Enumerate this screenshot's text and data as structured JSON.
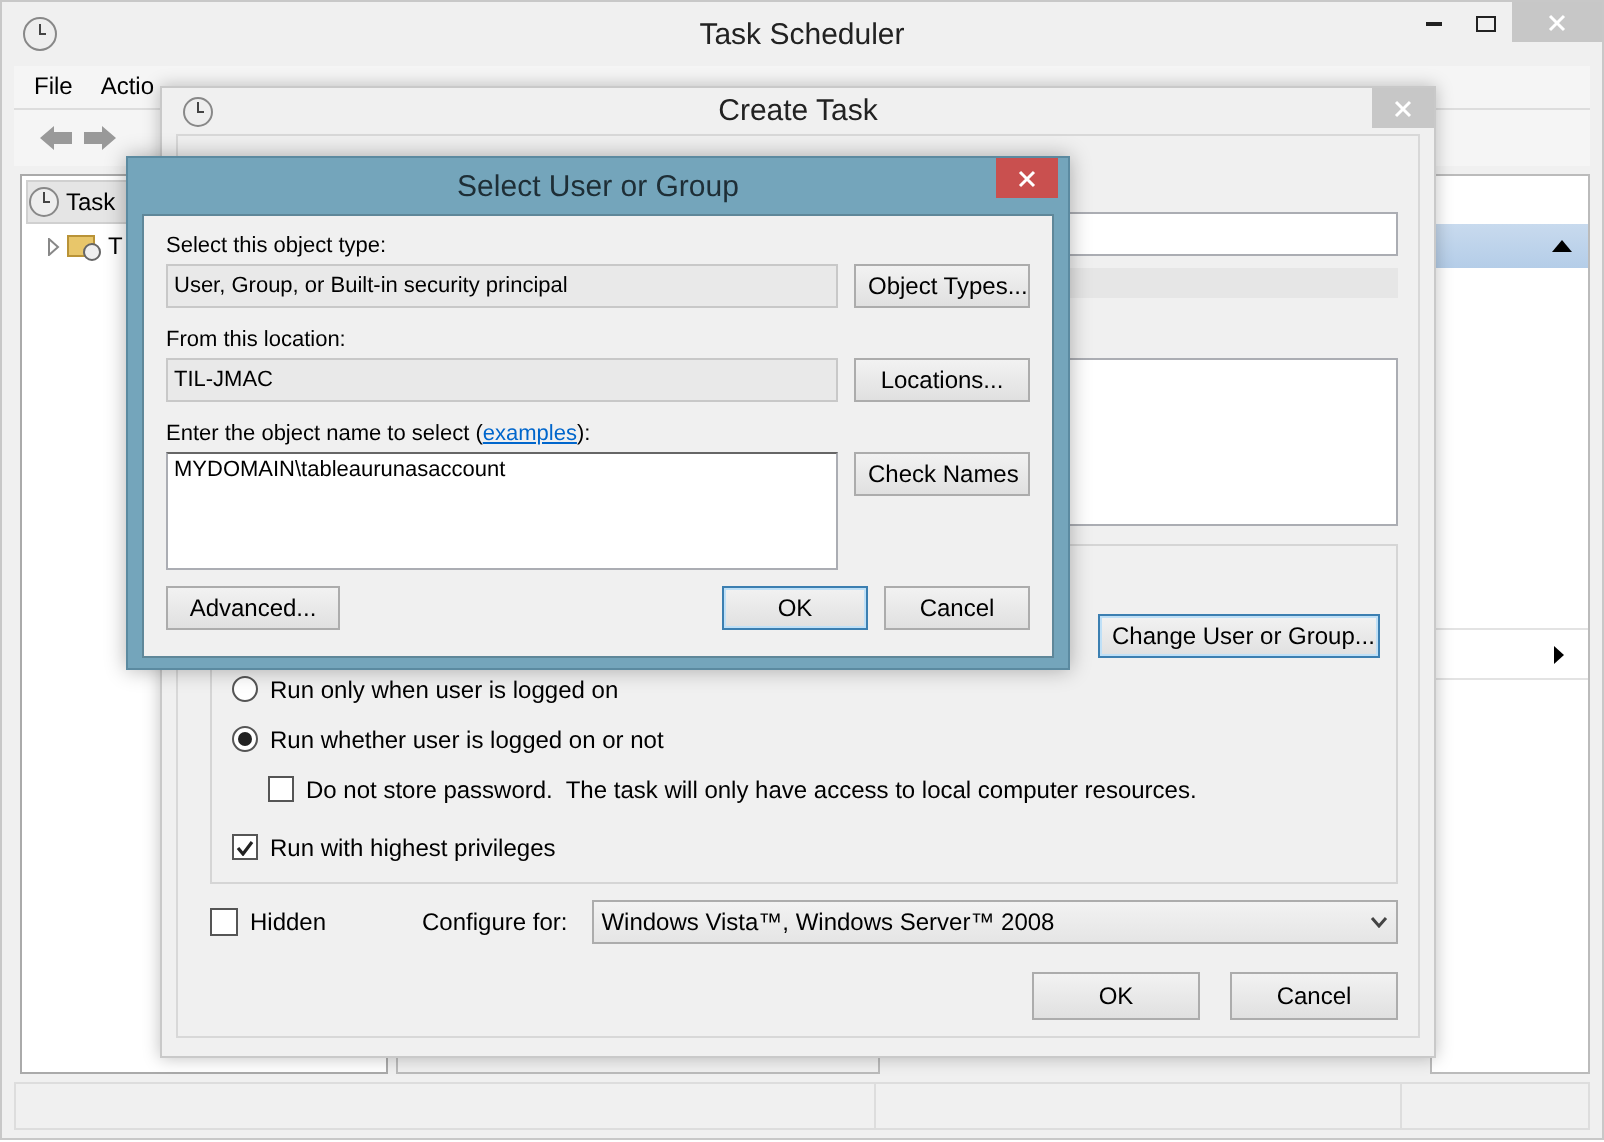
{
  "main_window": {
    "title": "Task Scheduler",
    "menu": [
      "File",
      "Actio"
    ],
    "tree": [
      {
        "label": "Task",
        "selected": true,
        "children": [
          {
            "label": "T",
            "expanded": false
          }
        ]
      }
    ]
  },
  "create_task": {
    "title": "Create Task",
    "change_user_button": "Change User or Group...",
    "logon_options": [
      {
        "label": "Run only when user is logged on",
        "selected": false
      },
      {
        "label": "Run whether user is logged on or not",
        "selected": true
      }
    ],
    "do_not_store_password": {
      "label": "Do not store password.  The task will only have access to local computer resources.",
      "checked": false
    },
    "highest_privileges": {
      "label": "Run with highest privileges",
      "checked": true
    },
    "hidden": {
      "label": "Hidden",
      "checked": false
    },
    "configure_for": {
      "label": "Configure for:",
      "value": "Windows Vista™, Windows Server™ 2008"
    },
    "buttons": [
      "OK",
      "Cancel"
    ]
  },
  "select_dialog": {
    "title": "Select User or Group",
    "object_type_label": "Select this object type:",
    "object_type": "User, Group, or Built-in security principal",
    "object_types_button": "Object Types...",
    "location_label": "From this location:",
    "location": "TIL-JMAC",
    "locations_button": "Locations...",
    "object_name_label_before": "Enter the object name to select (",
    "examples_link": "examples",
    "object_name_label_after": "):",
    "object_name": "MYDOMAIN\\tableaurunasaccount",
    "check_names_button": "Check Names",
    "advanced_button": "Advanced...",
    "buttons": [
      "OK",
      "Cancel"
    ]
  }
}
